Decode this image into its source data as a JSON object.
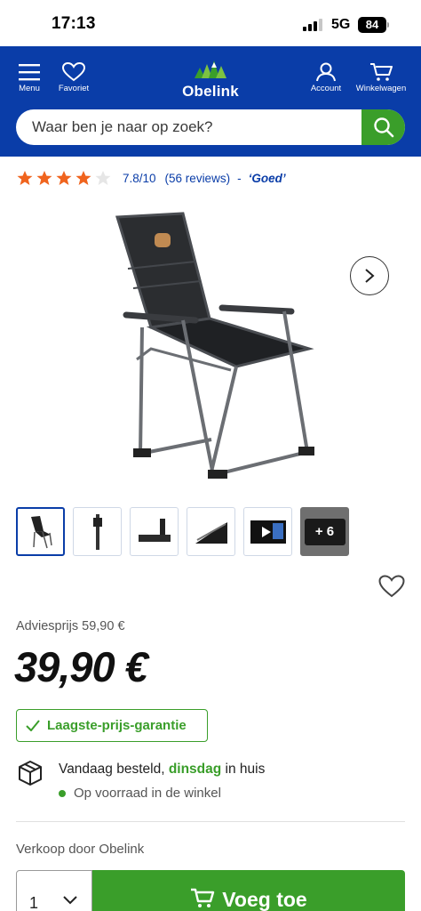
{
  "status_bar": {
    "time": "17:13",
    "network": "5G",
    "battery": "84"
  },
  "header": {
    "menu_label": "Menu",
    "favorites_label": "Favoriet",
    "brand": "Obelink",
    "account_label": "Account",
    "cart_label": "Winkelwagen"
  },
  "search": {
    "placeholder": "Waar ben je naar op zoek?"
  },
  "rating": {
    "stars_filled": 4,
    "stars_total": 5,
    "score": "7.8/10",
    "reviews": "(56 reviews)",
    "separator": "-",
    "label": "‘Goed’"
  },
  "gallery": {
    "more_count": "+ 6"
  },
  "pricing": {
    "advice_price": "Adviesprijs 59,90 €",
    "price": "39,90 €",
    "guarantee": "Laagste-prijs-garantie"
  },
  "delivery": {
    "prefix": "Vandaag besteld, ",
    "day": "dinsdag",
    "suffix": " in huis",
    "stock": "Op voorraad in de winkel"
  },
  "seller": "Verkoop door Obelink",
  "purchase": {
    "quantity": "1",
    "add_label": "Voeg toe"
  },
  "colors": {
    "brand_blue": "#0a3da8",
    "accent_green": "#3a9e2a",
    "star_orange": "#f0641e"
  }
}
